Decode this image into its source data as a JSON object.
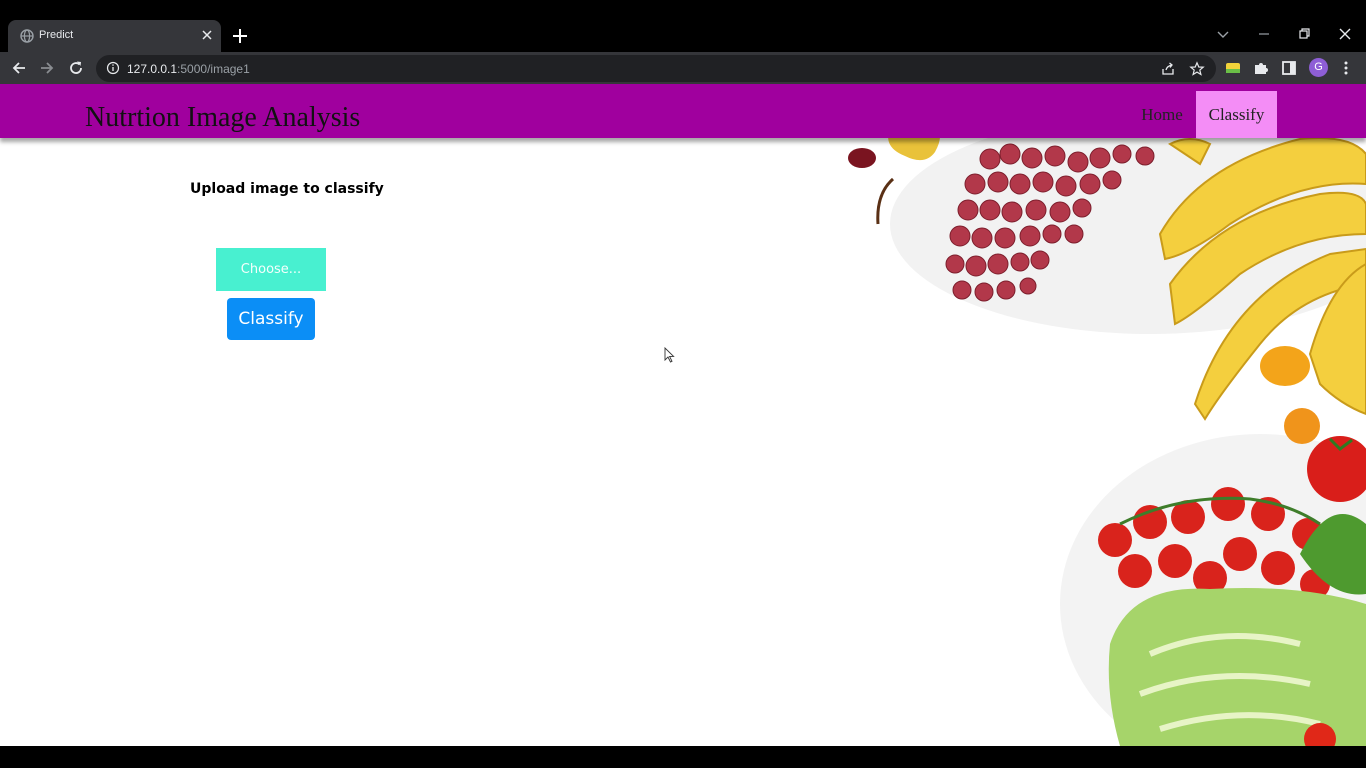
{
  "browser": {
    "tab_title": "Predict",
    "url_host": "127.0.0.1",
    "url_rest": ":5000/image1",
    "profile_initial": "G",
    "icons": [
      "globe-icon",
      "close-icon",
      "plus-icon",
      "chevron-down-icon",
      "minimize-icon",
      "restore-icon",
      "window-close-icon",
      "back-icon",
      "forward-icon",
      "reload-icon",
      "info-icon",
      "share-icon",
      "star-icon",
      "extension-icon",
      "puzzle-icon",
      "side-panel-icon",
      "kebab-menu-icon"
    ]
  },
  "page": {
    "brand": "Nutrtion Image Analysis",
    "nav": {
      "home": "Home",
      "classify": "Classify"
    },
    "upload_title": "Upload image to classify",
    "choose_label": "Choose...",
    "classify_label": "Classify"
  },
  "colors": {
    "nav_bg": "#a0009e",
    "nav_active": "#f48df6",
    "choose_bg": "#48f0d0",
    "classify_bg": "#0b8ef6"
  }
}
